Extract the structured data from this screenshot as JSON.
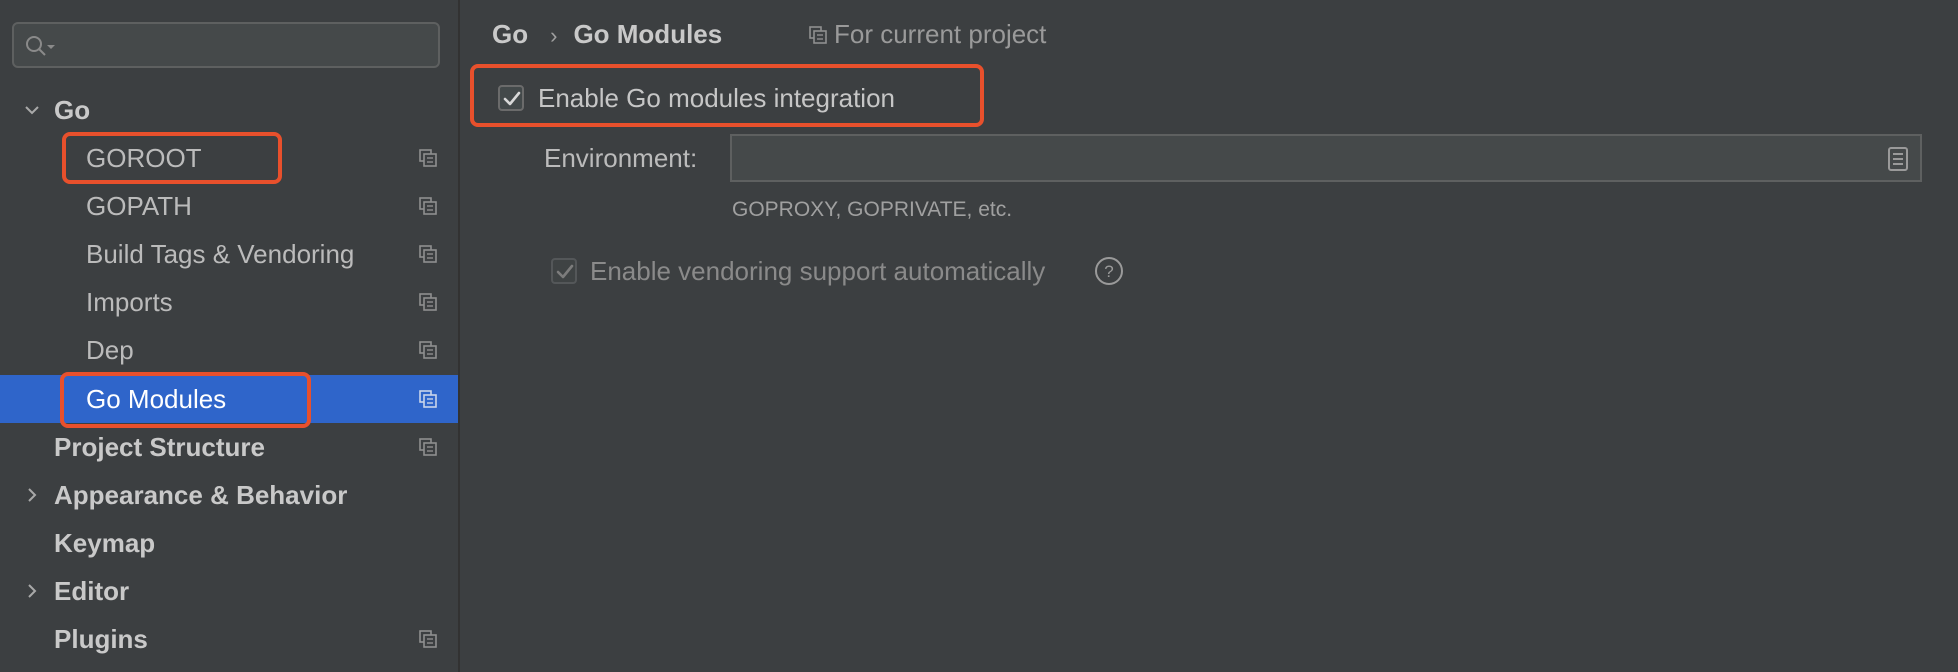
{
  "sidebar": {
    "search": {
      "value": "",
      "placeholder": ""
    },
    "items": [
      {
        "label": "Go",
        "bold": true,
        "chevron": "expanded",
        "copy_icon": false
      },
      {
        "label": "GOROOT",
        "bold": false,
        "copy_icon": true
      },
      {
        "label": "GOPATH",
        "bold": false,
        "copy_icon": true
      },
      {
        "label": "Build Tags & Vendoring",
        "bold": false,
        "copy_icon": true
      },
      {
        "label": "Imports",
        "bold": false,
        "copy_icon": true
      },
      {
        "label": "Dep",
        "bold": false,
        "copy_icon": true
      },
      {
        "label": "Go Modules",
        "bold": false,
        "copy_icon": true,
        "selected": true
      },
      {
        "label": "Project Structure",
        "bold": true,
        "copy_icon": true
      },
      {
        "label": "Appearance & Behavior",
        "bold": true,
        "chevron": "collapsed",
        "copy_icon": false
      },
      {
        "label": "Keymap",
        "bold": true,
        "copy_icon": false
      },
      {
        "label": "Editor",
        "bold": true,
        "chevron": "collapsed",
        "copy_icon": false
      },
      {
        "label": "Plugins",
        "bold": true,
        "copy_icon": true
      }
    ]
  },
  "main": {
    "breadcrumb": {
      "parent": "Go",
      "current": "Go Modules"
    },
    "scope_label": "For current project",
    "enable_modules": {
      "label": "Enable Go modules integration",
      "checked": true
    },
    "environment": {
      "label": "Environment:",
      "value": "",
      "hint": "GOPROXY, GOPRIVATE, etc."
    },
    "vendoring": {
      "label": "Enable vendoring support automatically",
      "checked": true,
      "disabled": true
    }
  },
  "colors": {
    "background": "#3c3f41",
    "selection": "#2f65ca",
    "annotation": "#e8502c",
    "text": "#bbbbbb",
    "text_disabled": "#8a8a8a"
  },
  "icons": {
    "search": "search-icon",
    "copy": "project-scope-icon",
    "browse": "browse-icon",
    "help": "help-icon",
    "chevron_expanded": "chevron-down-icon",
    "chevron_collapsed": "chevron-right-icon"
  }
}
